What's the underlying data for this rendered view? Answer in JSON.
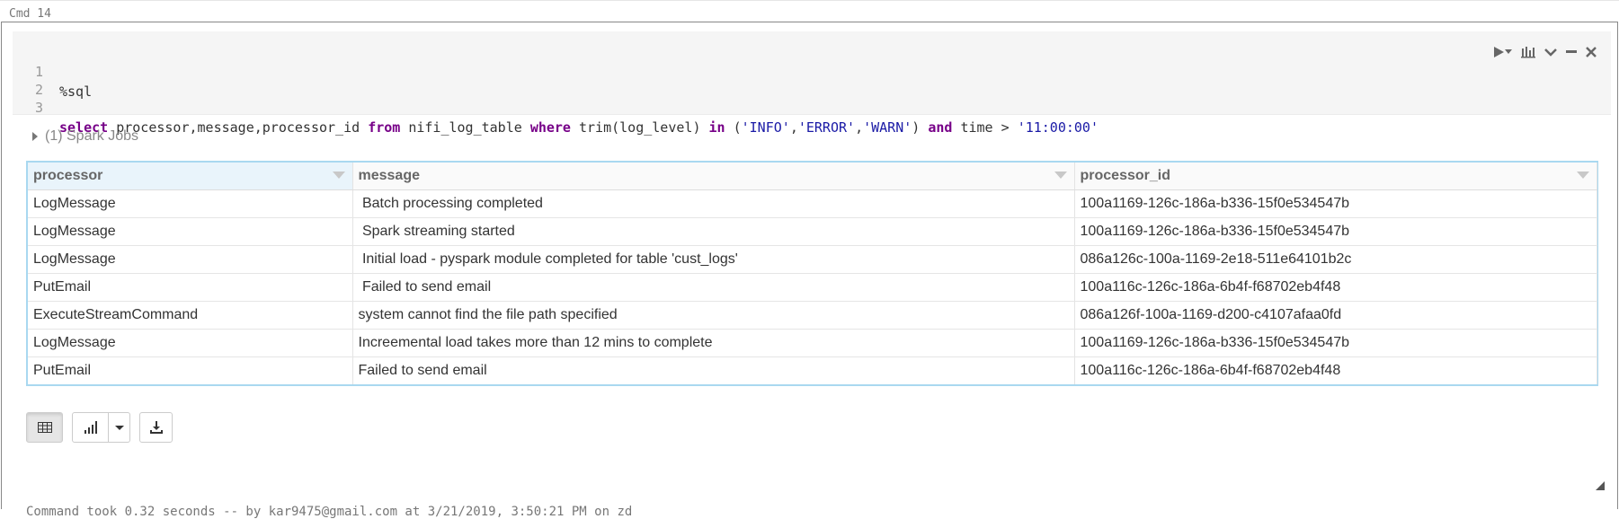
{
  "cell_label": "Cmd 14",
  "code": {
    "lines": [
      {
        "num": "1",
        "text": "%sql"
      },
      {
        "num": "2",
        "text": ""
      },
      {
        "num": "3",
        "text": "select processor,message,processor_id from nifi_log_table where trim(log_level) in ('INFO','ERROR','WARN') and time > '11:00:00'"
      }
    ]
  },
  "toolbar": {
    "icons": [
      "run-icon",
      "dropdown-icon",
      "chart-icon",
      "chevron-down-icon",
      "minimize-icon",
      "close-icon"
    ]
  },
  "spark_jobs_label": "(1) Spark Jobs",
  "table": {
    "columns": [
      "processor",
      "message",
      "processor_id"
    ],
    "rows": [
      [
        "LogMessage",
        " Batch processing completed",
        "100a1169-126c-186a-b336-15f0e534547b"
      ],
      [
        "LogMessage",
        " Spark streaming started",
        "100a1169-126c-186a-b336-15f0e534547b"
      ],
      [
        "LogMessage",
        " Initial load - pyspark module completed for table 'cust_logs'",
        "086a126c-100a-1169-2e18-511e64101b2c"
      ],
      [
        "PutEmail",
        " Failed to send email",
        "100a116c-126c-186a-6b4f-f68702eb4f48"
      ],
      [
        "ExecuteStreamCommand",
        "system cannot find the file path specified",
        "086a126f-100a-1169-d200-c4107afaa0fd"
      ],
      [
        "LogMessage",
        "Increemental load takes more than 12 mins to complete",
        "100a1169-126c-186a-b336-15f0e534547b"
      ],
      [
        "PutEmail",
        "Failed to send email",
        "100a116c-126c-186a-6b4f-f68702eb4f48"
      ]
    ]
  },
  "footer": "Command took 0.32 seconds -- by kar9475@gmail.com at 3/21/2019, 3:50:21 PM on zd",
  "colors": {
    "keyword": "#770088",
    "string": "#1a1aa6",
    "table_border": "#a9d8f0"
  }
}
